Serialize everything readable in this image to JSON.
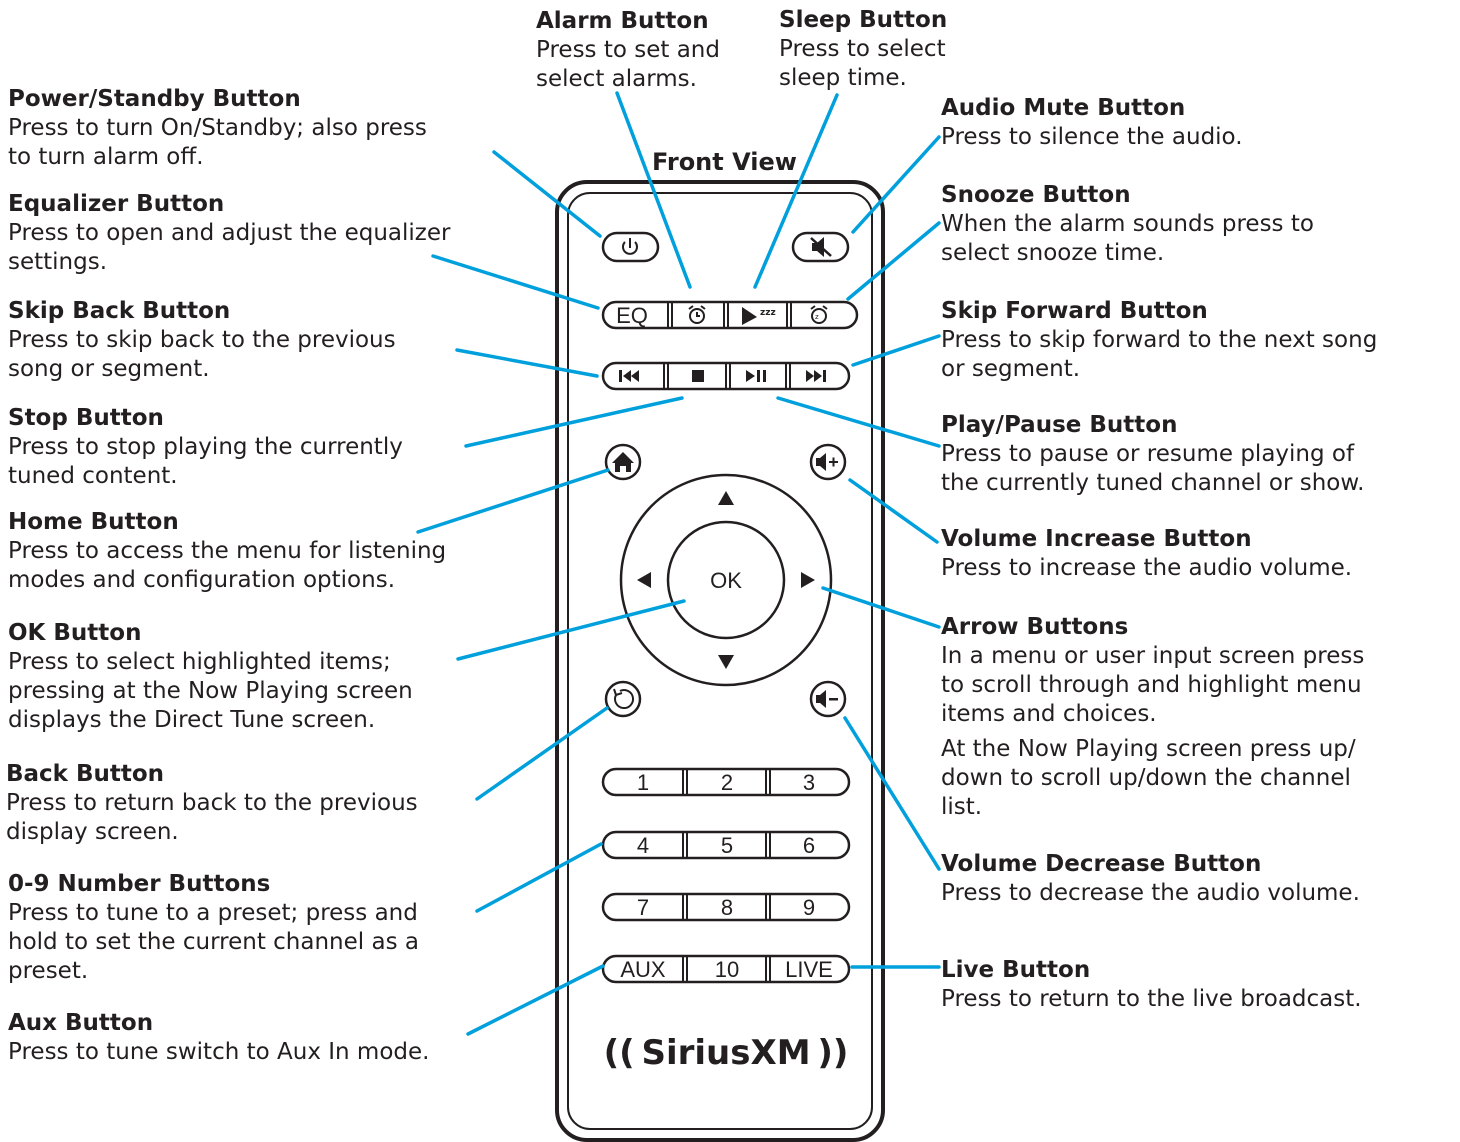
{
  "title": "Front View",
  "brand": {
    "logo_text": "SiriusXM",
    "logo_prefix": "(( ",
    "logo_suffix": " ))"
  },
  "accent_color": "#00a0dc",
  "remote_buttons": {
    "eq": "EQ",
    "ok": "OK",
    "num_1": "1",
    "num_2": "2",
    "num_3": "3",
    "num_4": "4",
    "num_5": "5",
    "num_6": "6",
    "num_7": "7",
    "num_8": "8",
    "num_9": "9",
    "aux": "AUX",
    "num_10": "10",
    "live": "LIVE"
  },
  "callouts": {
    "power": {
      "title": "Power/Standby Button",
      "lines": [
        "Press to turn On/Standby; also press",
        "to turn alarm off."
      ]
    },
    "equalizer": {
      "title": "Equalizer Button",
      "lines": [
        "Press to open and adjust the equalizer",
        "settings."
      ]
    },
    "skip_back": {
      "title": "Skip Back Button",
      "lines": [
        "Press to skip back to the previous",
        "song or segment."
      ]
    },
    "stop": {
      "title": "Stop Button",
      "lines": [
        "Press to stop playing the currently",
        "tuned content."
      ]
    },
    "home": {
      "title": "Home Button",
      "lines": [
        "Press to access the menu for listening",
        "modes and configuration options."
      ]
    },
    "ok": {
      "title": "OK Button",
      "lines": [
        "Press to select highlighted items;",
        "pressing at the Now Playing screen",
        "displays the Direct Tune screen."
      ]
    },
    "back": {
      "title": "Back Button",
      "lines": [
        "Press to return back to the previous",
        "display screen."
      ]
    },
    "numbers": {
      "title": "0-9 Number Buttons",
      "lines": [
        "Press to tune to a preset; press and",
        "hold to set the current channel as a",
        "preset."
      ]
    },
    "aux": {
      "title": "Aux Button",
      "lines": [
        "Press to tune switch to Aux In mode."
      ]
    },
    "alarm": {
      "title": "Alarm Button",
      "lines": [
        "Press to set and",
        "select alarms."
      ]
    },
    "sleep": {
      "title": "Sleep Button",
      "lines": [
        "Press to select",
        "sleep time."
      ]
    },
    "mute": {
      "title": "Audio Mute Button",
      "lines": [
        "Press to silence the audio."
      ]
    },
    "snooze": {
      "title": "Snooze Button",
      "lines": [
        "When the alarm sounds press to",
        "select snooze time."
      ]
    },
    "skip_forward": {
      "title": "Skip Forward Button",
      "lines": [
        "Press to skip forward to the next song",
        "or segment."
      ]
    },
    "play_pause": {
      "title": "Play/Pause Button",
      "lines": [
        "Press to pause or resume playing of",
        "the currently tuned channel or show."
      ]
    },
    "volume_up": {
      "title": "Volume Increase Button",
      "lines": [
        "Press to increase the audio volume."
      ]
    },
    "arrows": {
      "title": "Arrow Buttons",
      "lines": [
        "In a menu or user input screen press",
        "to scroll through and highlight menu",
        "items and choices.",
        "At the Now Playing screen press up/",
        "down to scroll up/down the channel",
        "list."
      ]
    },
    "volume_down": {
      "title": "Volume Decrease Button",
      "lines": [
        "Press to decrease the audio volume."
      ]
    },
    "live": {
      "title": "Live Button",
      "lines": [
        "Press to return to the live broadcast."
      ]
    }
  }
}
